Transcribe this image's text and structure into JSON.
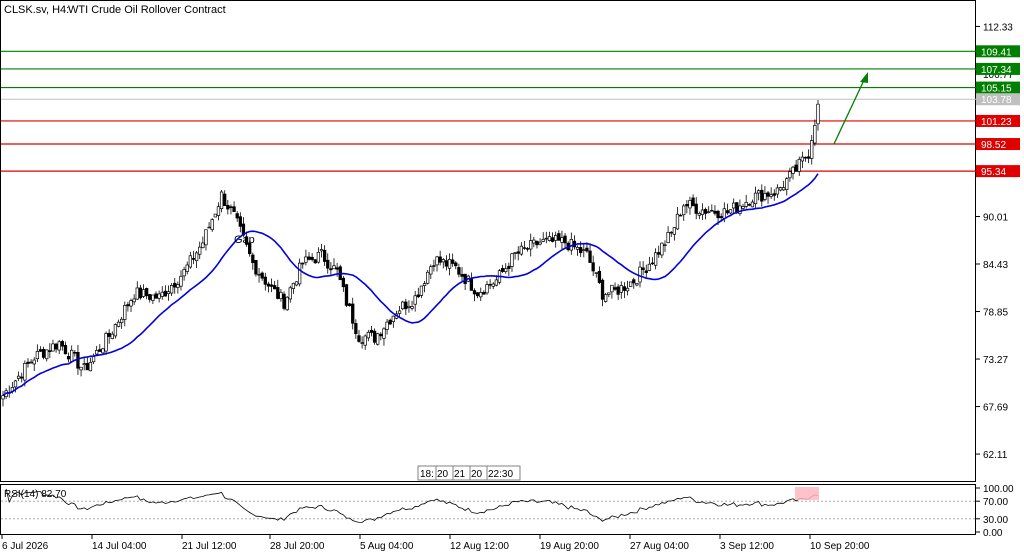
{
  "header": {
    "symbol": "CLSK.sv, H4:",
    "description": "WTI Crude Oil Rollover Contract"
  },
  "price_axis": {
    "ticks": [
      "112.33",
      "106.77",
      "101.23",
      "95.67",
      "90.01",
      "84.43",
      "78.85",
      "73.27",
      "67.69",
      "62.11"
    ],
    "ylim": [
      59.3,
      115.2
    ]
  },
  "levels": [
    {
      "value": 109.41,
      "label": "109.41",
      "color": "#008000"
    },
    {
      "value": 107.34,
      "label": "107.34",
      "color": "#008000"
    },
    {
      "value": 105.15,
      "label": "105.15",
      "color": "#008000"
    },
    {
      "value": 101.23,
      "label": "101.23",
      "color": "#e00000"
    },
    {
      "value": 98.52,
      "label": "98.52",
      "color": "#e00000"
    },
    {
      "value": 95.34,
      "label": "95.34",
      "color": "#e00000"
    }
  ],
  "current_price": {
    "value": 103.78,
    "label": "103.78",
    "color": "#c0c0c0"
  },
  "annotations": {
    "gap_text": "Gap",
    "arrow": "up",
    "arrow_color": "#008000"
  },
  "time_axis": {
    "labels": [
      "6 Jul 2026",
      "14 Jul 04:00",
      "21 Jul 12:00",
      "28 Jul 20:00",
      "5 Aug 04:00",
      "12 Aug 12:00",
      "19 Aug 20:00",
      "27 Aug 04:00",
      "3 Sep 12:00",
      "10 Sep 20:00"
    ]
  },
  "scroll_box": {
    "items": [
      "18:",
      "20",
      "21",
      "20",
      "22:30"
    ]
  },
  "rsi": {
    "label": "RSI(14) 82.70",
    "value": 82.7,
    "ticks": [
      "100.00",
      "70.00",
      "30.00",
      "0.00"
    ],
    "levels": [
      70,
      30
    ],
    "ylim": [
      0,
      100
    ],
    "color": "#000000"
  },
  "chart_data": {
    "type": "candlestick",
    "title": "CLSK.sv, H4: WTI Crude Oil Rollover Contract",
    "ylim": [
      59.3,
      115.2
    ],
    "anchors": [
      {
        "bar": 0,
        "price": 69.0
      },
      {
        "bar": 10,
        "price": 73.5
      },
      {
        "bar": 18,
        "price": 75.2
      },
      {
        "bar": 26,
        "price": 72.0
      },
      {
        "bar": 34,
        "price": 76.0
      },
      {
        "bar": 42,
        "price": 81.0
      },
      {
        "bar": 50,
        "price": 80.5
      },
      {
        "bar": 58,
        "price": 83.5
      },
      {
        "bar": 64,
        "price": 87.0
      },
      {
        "bar": 70,
        "price": 92.5
      },
      {
        "bar": 74,
        "price": 90.0
      },
      {
        "bar": 80,
        "price": 84.5
      },
      {
        "bar": 86,
        "price": 81.5
      },
      {
        "bar": 90,
        "price": 80.0
      },
      {
        "bar": 96,
        "price": 84.5
      },
      {
        "bar": 102,
        "price": 85.5
      },
      {
        "bar": 107,
        "price": 83.5
      },
      {
        "bar": 110,
        "price": 80.0
      },
      {
        "bar": 114,
        "price": 76.0
      },
      {
        "bar": 119,
        "price": 75.8
      },
      {
        "bar": 126,
        "price": 79.0
      },
      {
        "bar": 132,
        "price": 80.5
      },
      {
        "bar": 138,
        "price": 85.0
      },
      {
        "bar": 145,
        "price": 84.0
      },
      {
        "bar": 152,
        "price": 81.2
      },
      {
        "bar": 158,
        "price": 82.5
      },
      {
        "bar": 164,
        "price": 85.5
      },
      {
        "bar": 172,
        "price": 87.0
      },
      {
        "bar": 180,
        "price": 87.0
      },
      {
        "bar": 187,
        "price": 85.5
      },
      {
        "bar": 192,
        "price": 81.0
      },
      {
        "bar": 196,
        "price": 81.2
      },
      {
        "bar": 202,
        "price": 82.5
      },
      {
        "bar": 208,
        "price": 85.0
      },
      {
        "bar": 214,
        "price": 88.0
      },
      {
        "bar": 218,
        "price": 91.5
      },
      {
        "bar": 224,
        "price": 90.8
      },
      {
        "bar": 232,
        "price": 90.5
      },
      {
        "bar": 240,
        "price": 92.3
      },
      {
        "bar": 248,
        "price": 93.0
      },
      {
        "bar": 254,
        "price": 95.5
      },
      {
        "bar": 258,
        "price": 97.5
      },
      {
        "bar": 261,
        "price": 103.2
      }
    ],
    "moving_average": {
      "color": "#0000e0"
    }
  }
}
